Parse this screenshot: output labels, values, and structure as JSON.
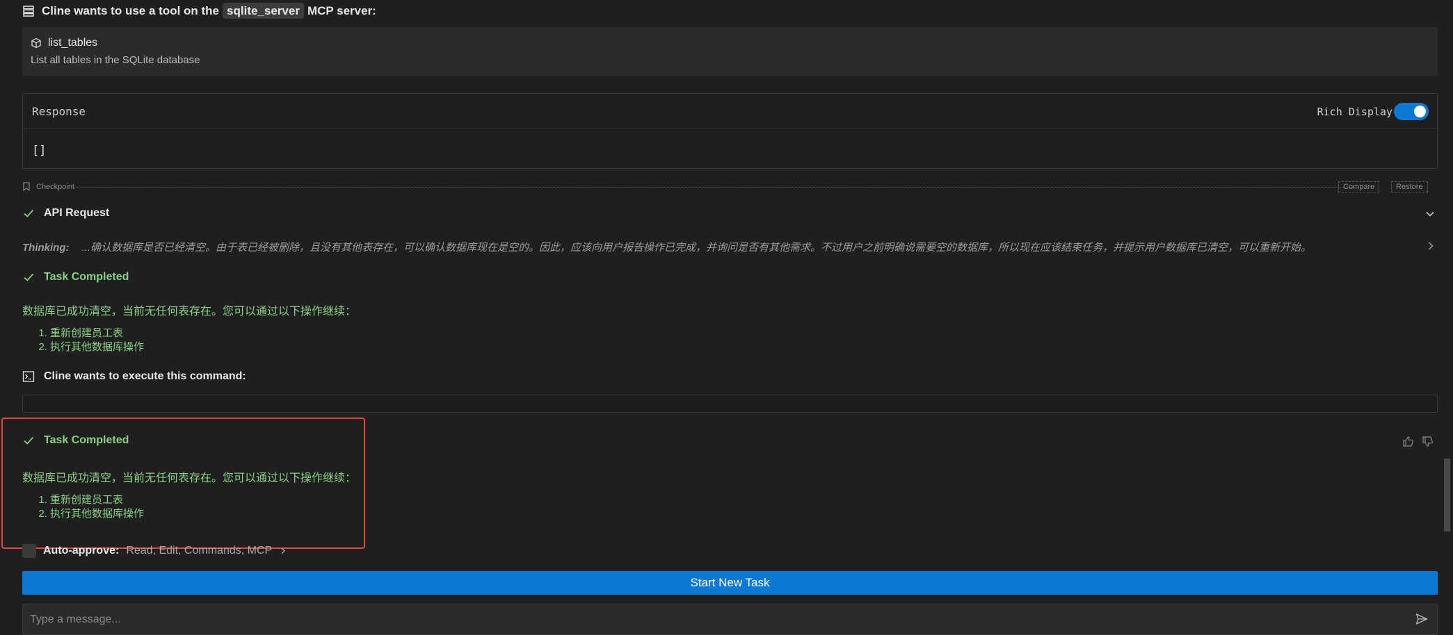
{
  "mcp_header": {
    "prefix": "Cline wants to use a tool on the",
    "server": "sqlite_server",
    "suffix": "MCP server:"
  },
  "tool": {
    "name": "list_tables",
    "description": "List all tables in the SQLite database"
  },
  "response": {
    "title": "Response",
    "rich_display_label": "Rich Display",
    "rich_display_on": true,
    "body": "[]"
  },
  "checkpoint": {
    "label": "Checkpoint",
    "compare": "Compare",
    "restore": "Restore"
  },
  "api_request": {
    "title": "API Request"
  },
  "thinking": {
    "label": "Thinking:",
    "text": "...确认数据库是否已经清空。由于表已经被删除，且没有其他表存在，可以确认数据库现在是空的。因此，应该向用户报告操作已完成，并询问是否有其他需求。不过用户之前明确说需要空的数据库，所以现在应该结束任务，并提示用户数据库已清空，可以重新开始。"
  },
  "task_completed_1": {
    "title": "Task Completed",
    "message": "数据库已成功清空，当前无任何表存在。您可以通过以下操作继续：",
    "items": [
      "重新创建员工表",
      "执行其他数据库操作"
    ]
  },
  "execute": {
    "title": "Cline wants to execute this command:"
  },
  "task_completed_2": {
    "title": "Task Completed",
    "message": "数据库已成功清空，当前无任何表存在。您可以通过以下操作继续：",
    "items": [
      "重新创建员工表",
      "执行其他数据库操作"
    ]
  },
  "auto_approve": {
    "label": "Auto-approve:",
    "items": "Read, Edit, Commands, MCP"
  },
  "start_new_task": "Start New Task",
  "message_input": {
    "placeholder": "Type a message...",
    "value": ""
  },
  "colors": {
    "accent": "#0e78d5",
    "success": "#89d185",
    "highlight": "#e04a3f",
    "background": "#1f1f1f"
  },
  "icons": [
    "server-icon",
    "tool-icon",
    "bookmark-icon",
    "check-icon",
    "chevron-down-icon",
    "chevron-right-icon",
    "terminal-icon",
    "thumbs-up-icon",
    "thumbs-down-icon",
    "send-icon"
  ]
}
